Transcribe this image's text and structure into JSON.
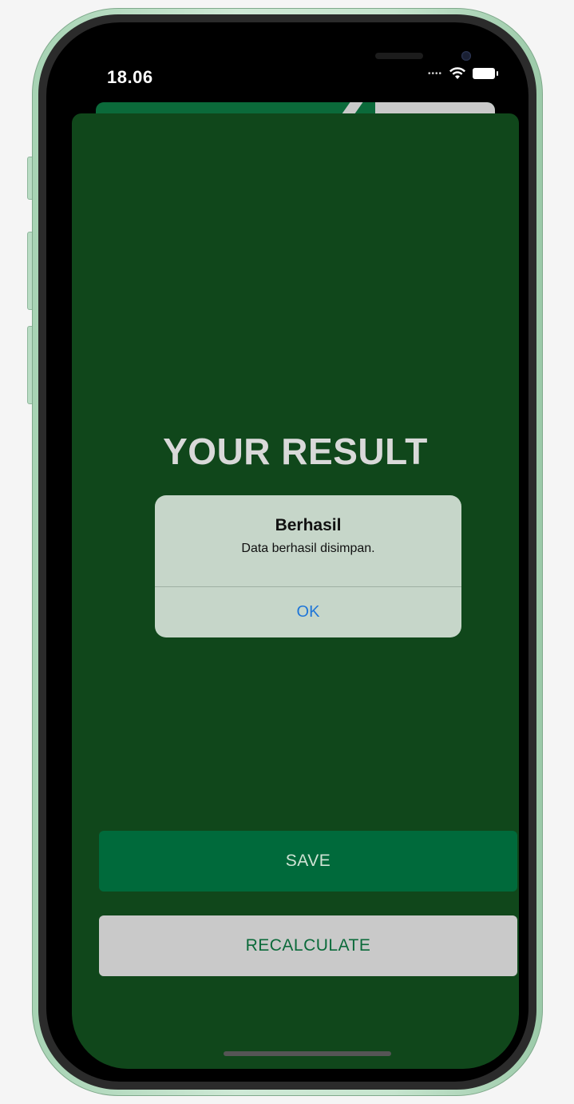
{
  "status_bar": {
    "time": "18.06",
    "signal_icon": "signal-dots-icon",
    "wifi_icon": "wifi-icon",
    "battery_icon": "battery-icon"
  },
  "result": {
    "title": "YOUR RESULT"
  },
  "alert": {
    "title": "Berhasil",
    "message": "Data berhasil disimpan.",
    "ok_label": "OK"
  },
  "actions": {
    "save_label": "SAVE",
    "recalculate_label": "RECALCULATE"
  },
  "colors": {
    "card_background": "#10471b",
    "primary_button": "#006a3b",
    "secondary_button": "#c9c9c9",
    "alert_background": "#c6d6c9",
    "alert_action": "#1f76d8"
  }
}
